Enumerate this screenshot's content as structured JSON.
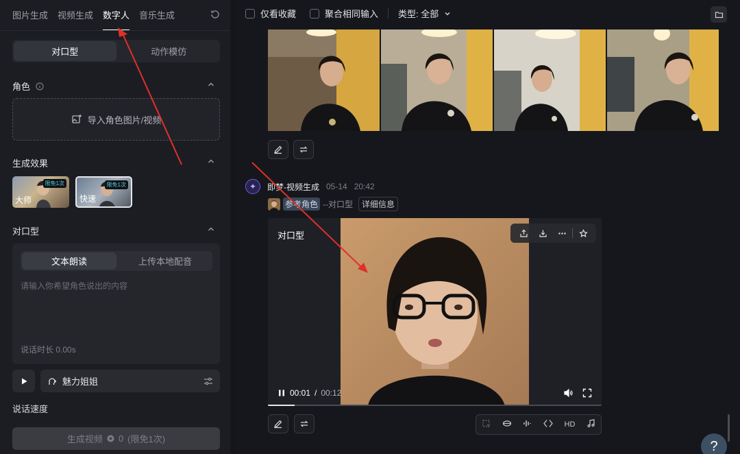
{
  "left": {
    "tabs": [
      "图片生成",
      "视频生成",
      "数字人",
      "音乐生成"
    ],
    "mode_tabs": [
      "对口型",
      "动作模仿"
    ],
    "role_section": {
      "title": "角色",
      "import_label": "导入角色图片/视频"
    },
    "effect_section": {
      "title": "生成效果",
      "options": [
        {
          "label": "大师",
          "badge": "限免1次"
        },
        {
          "label": "快速",
          "badge": "限免1次"
        }
      ]
    },
    "lip_section": {
      "title": "对口型",
      "tabs": [
        "文本朗读",
        "上传本地配音"
      ],
      "placeholder": "请输入你希望角色说出的内容",
      "duration": "说话时长 0.00s"
    },
    "voice_name": "魅力姐姐",
    "speed_label": "说话速度",
    "generate": {
      "label": "生成视频",
      "cost": "0",
      "free": "(限免1次)"
    }
  },
  "right": {
    "toolbar": {
      "favorites_only": "仅看收藏",
      "merge_inputs": "聚合相同输入",
      "type_filter": "类型: 全部"
    },
    "generation": {
      "name": "即梦-视频生成",
      "date": "05-14",
      "time": "20:42",
      "ref_label": "参考角色",
      "ref_type": "--对口型",
      "detail": "详细信息"
    },
    "video": {
      "label": "对口型",
      "current": "00:01",
      "separator": "/",
      "duration": "00:12",
      "progress": 0.08
    },
    "bottom_tools": [
      "HD"
    ],
    "help": "?"
  },
  "colors": {
    "arrow": "#e0302a",
    "accent_badge": "#4fd2e6",
    "logo": "#6b5ce6"
  }
}
